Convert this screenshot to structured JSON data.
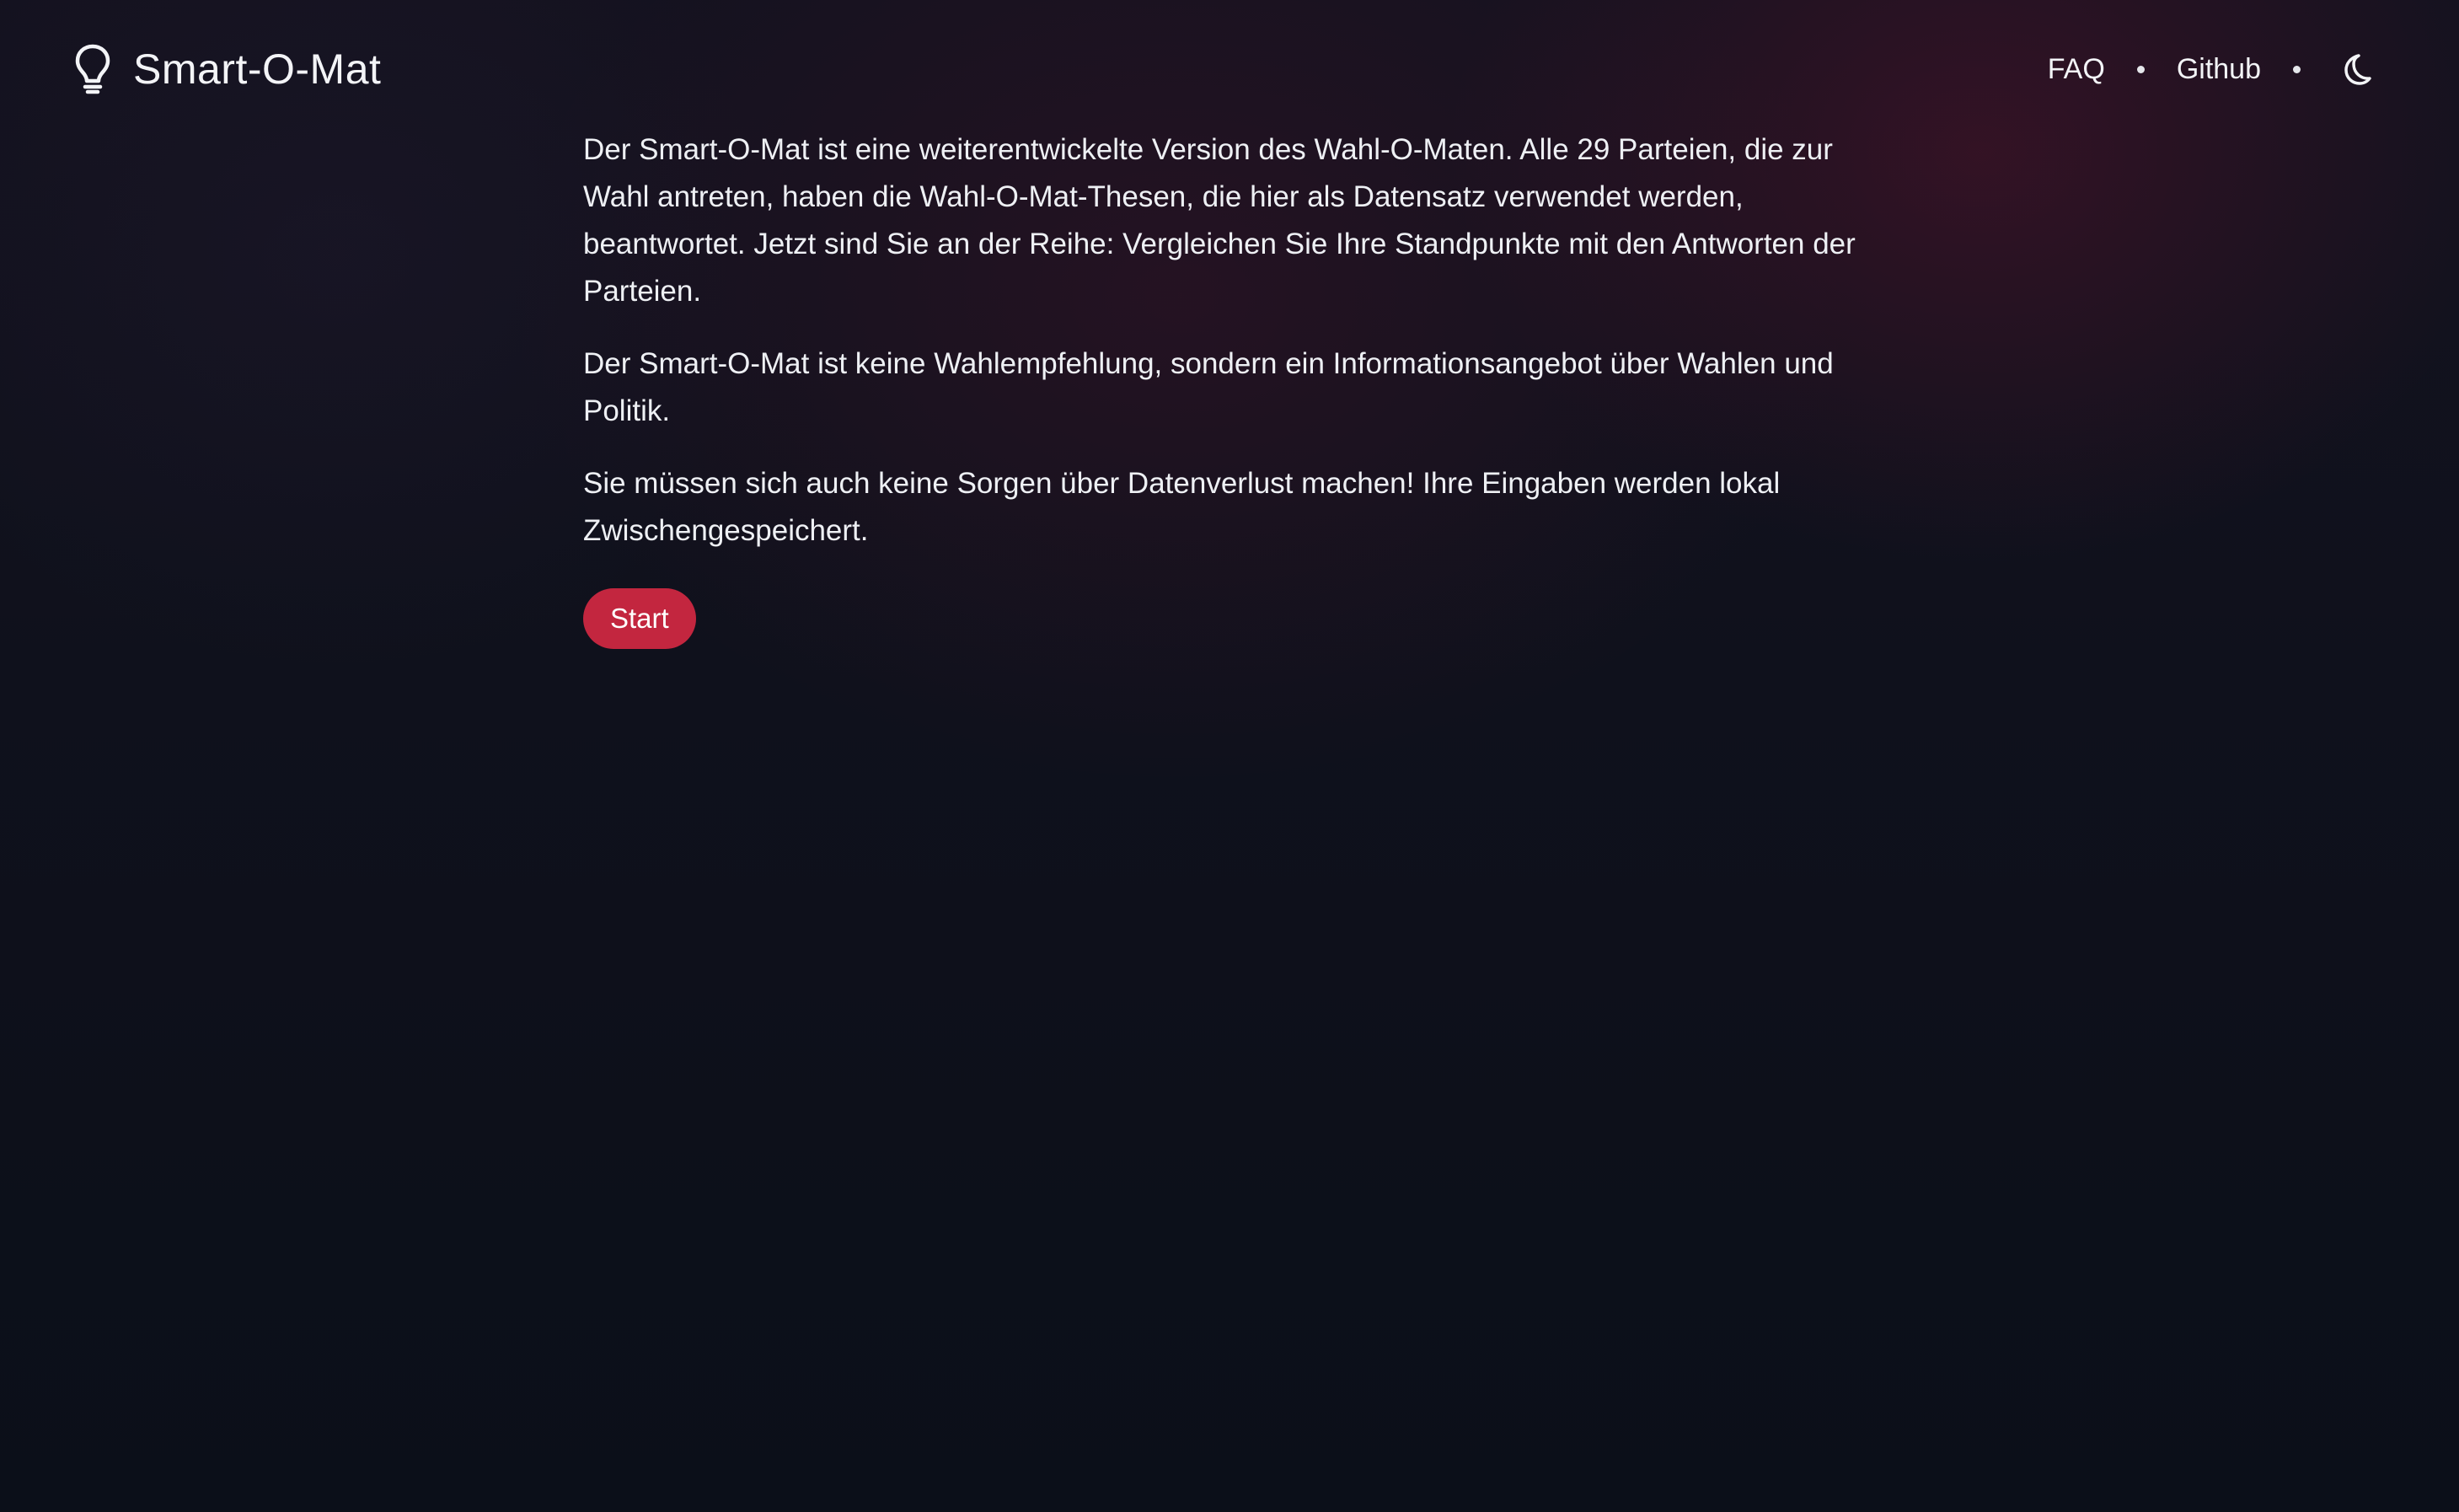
{
  "header": {
    "title": "Smart-O-Mat",
    "logo_icon": "lightbulb-icon",
    "nav": {
      "faq_label": "FAQ",
      "github_label": "Github",
      "theme_toggle_icon": "moon-icon"
    }
  },
  "main": {
    "paragraphs": [
      "Der Smart-O-Mat ist eine weiterentwickelte Version des Wahl-O-Maten. Alle 29 Parteien, die zur Wahl antreten, haben die Wahl-O-Mat-Thesen, die hier als Datensatz verwendet werden, beantwortet. Jetzt sind Sie an der Reihe: Vergleichen Sie Ihre Standpunkte mit den Antworten der Parteien.",
      "Der Smart-O-Mat ist keine Wahlempfehlung, sondern ein Informationsangebot über Wahlen und Politik.",
      "Sie müssen sich auch keine Sorgen über Datenverlust machen! Ihre Eingaben werden lokal Zwischengespeichert."
    ],
    "start_label": "Start"
  },
  "colors": {
    "background": "#0c111b",
    "accent": "#c3263f",
    "text": "#eef0f4"
  }
}
